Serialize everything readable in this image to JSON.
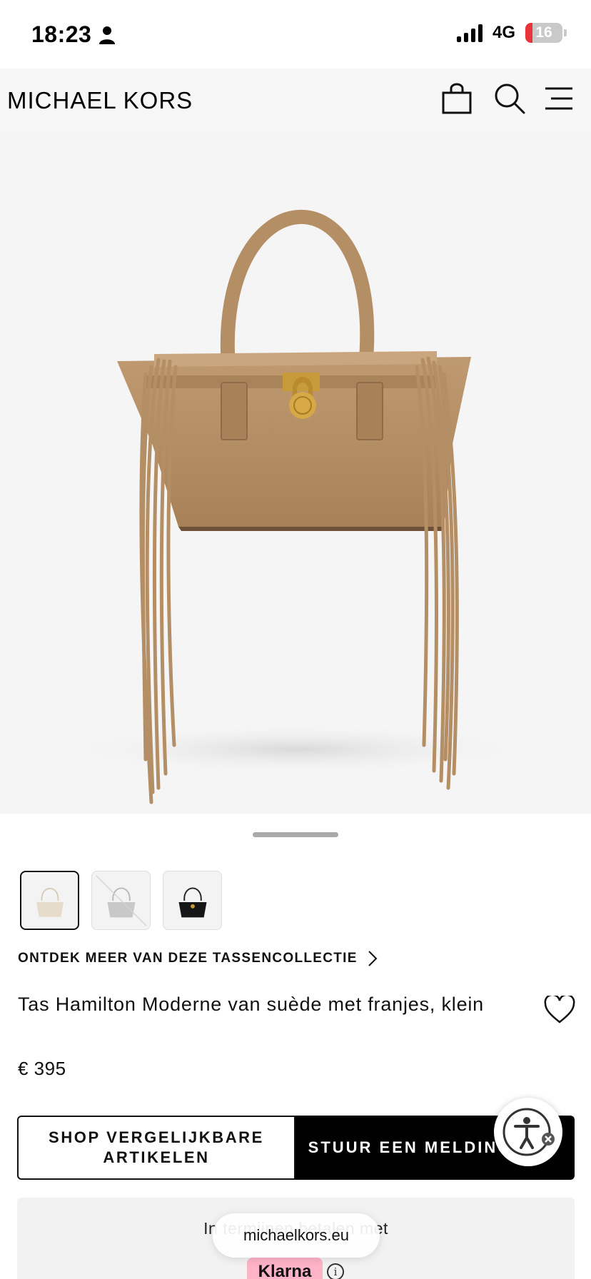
{
  "status_bar": {
    "time": "18:23",
    "network": "4G",
    "battery": "16"
  },
  "header": {
    "brand": "MICHAEL KORS",
    "icons": [
      "shopping-bag-icon",
      "search-icon",
      "menu-icon"
    ]
  },
  "product": {
    "swatches": [
      {
        "name": "cream",
        "selected": true
      },
      {
        "name": "grey",
        "selected": false
      },
      {
        "name": "black",
        "selected": false
      }
    ],
    "discover_label": "ONTDEK MEER VAN DEZE TASSENCOLLECTIE",
    "title": "Tas Hamilton Moderne van suède met franjes, klein",
    "price": "€ 395"
  },
  "actions": {
    "shop_similar": "SHOP VERGELIJKBARE ARTIKELEN",
    "notify": "STUUR EEN MELDING"
  },
  "klarna": {
    "text": "In termijnen betalen met",
    "badge": "Klarna",
    "info": "i"
  },
  "browser": {
    "url": "michaelkors.eu"
  },
  "colors": {
    "accent": "#000000",
    "klarna_pink": "#ffb3c7",
    "bag_suede": "#b48e64"
  }
}
